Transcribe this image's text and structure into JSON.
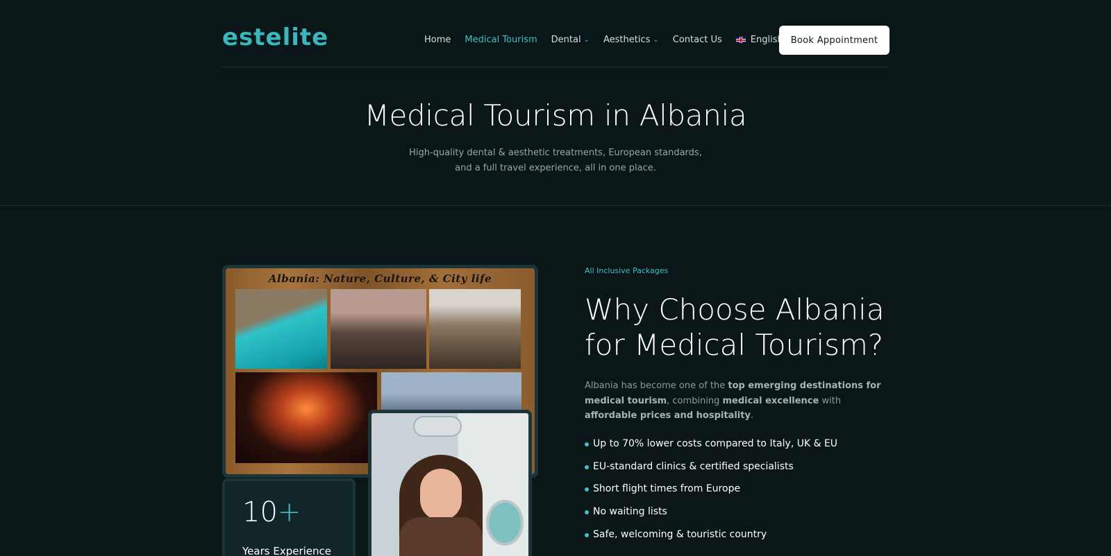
{
  "brand": {
    "logo_text": "estelite",
    "accent_color": "#40c0c6",
    "background": "#0a1618"
  },
  "nav": {
    "items": [
      {
        "label": "Home",
        "active": false,
        "dropdown": false
      },
      {
        "label": "Medical Tourism",
        "active": true,
        "dropdown": false
      },
      {
        "label": "Dental",
        "active": false,
        "dropdown": true
      },
      {
        "label": "Aesthetics",
        "active": false,
        "dropdown": true
      },
      {
        "label": "Contact Us",
        "active": false,
        "dropdown": false
      }
    ],
    "language": {
      "label": "English",
      "flag_icon": "uk-flag-icon"
    },
    "cta_label": "Book Appointment"
  },
  "hero": {
    "title": "Medical Tourism in Albania",
    "subtitle_line1": "High-quality dental & aesthetic treatments, European standards,",
    "subtitle_line2": "and a full travel experience, all in one place."
  },
  "collage": {
    "caption": "Albania: Nature, Culture, & City life"
  },
  "stat": {
    "number": "10",
    "suffix": "+",
    "label": "Years Experience"
  },
  "section": {
    "eyebrow": "All Inclusive Packages",
    "title_line1": "Why Choose Albania",
    "title_line2": "for Medical Tourism?",
    "para_part1": "Albania has become one of the ",
    "para_bold1": "top emerging destinations for medical tourism",
    "para_part2": ", combining ",
    "para_bold2": "medical excellence",
    "para_part3": " with ",
    "para_bold3": "affordable prices and hospitality",
    "para_part4": ".",
    "bullets": [
      "Up to 70% lower costs compared to Italy, UK & EU",
      "EU-standard clinics & certified specialists",
      "Short flight times from Europe",
      "No waiting lists",
      "Safe, welcoming & touristic country"
    ]
  }
}
